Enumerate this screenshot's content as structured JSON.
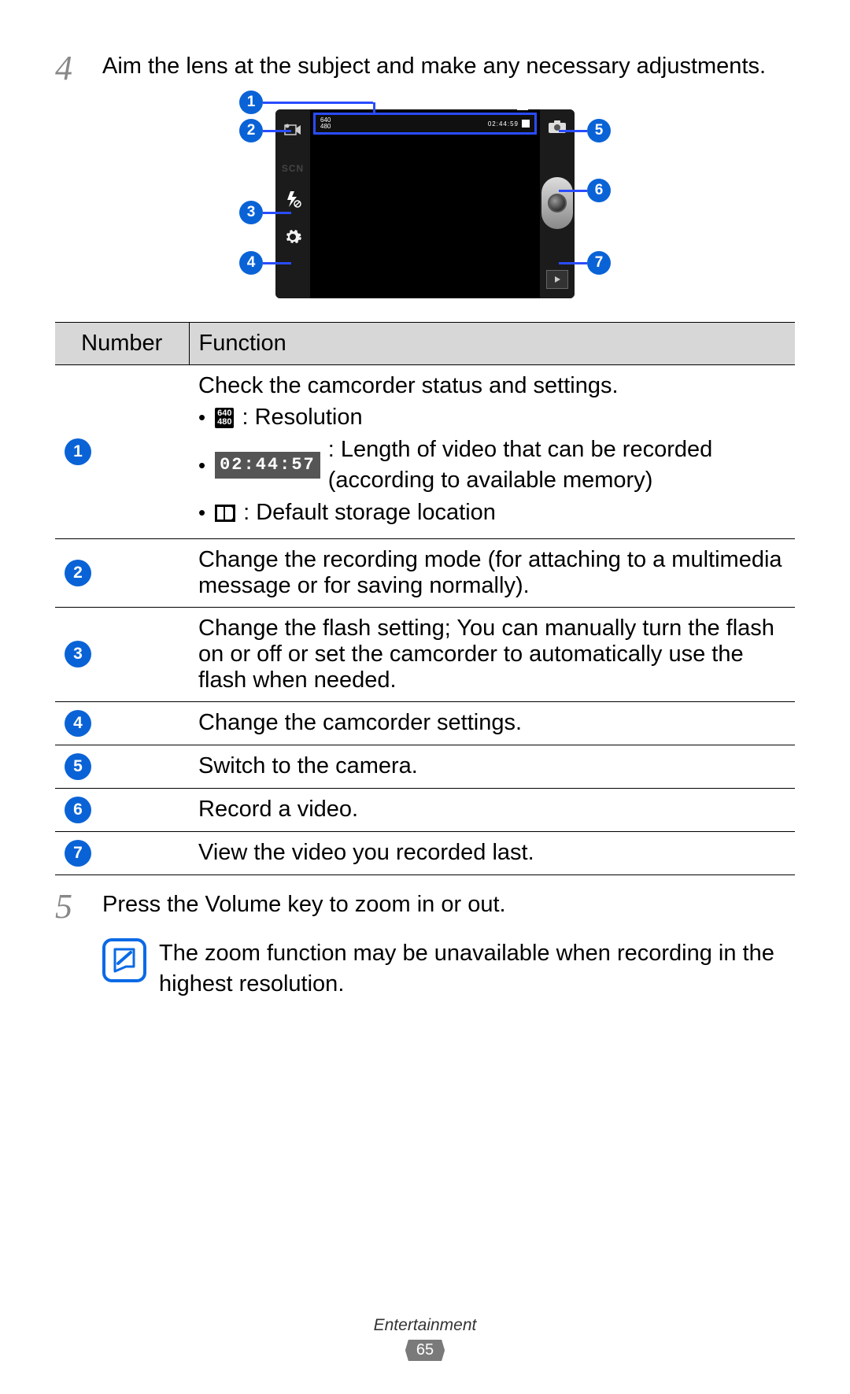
{
  "step4": {
    "num": "4",
    "text": "Aim the lens at the subject and make any necessary adjustments."
  },
  "diagram": {
    "status_res_top": "640",
    "status_res_bot": "480",
    "status_time": "02:44:59",
    "scn": "SCN"
  },
  "table": {
    "head_number": "Number",
    "head_function": "Function",
    "rows": [
      {
        "num": "1",
        "lead": "Check the camcorder status and settings.",
        "bullets": [
          {
            "icon": "res",
            "text": ": Resolution"
          },
          {
            "icon": "time",
            "text": ": Length of video that can be recorded (according to available memory)"
          },
          {
            "icon": "store",
            "text": ": Default storage location"
          }
        ]
      },
      {
        "num": "2",
        "text": "Change the recording mode (for attaching to a multimedia message or for saving normally)."
      },
      {
        "num": "3",
        "text": "Change the flash setting; You can manually turn the flash on or off or set the camcorder to automatically use the flash when needed."
      },
      {
        "num": "4",
        "text": "Change the camcorder settings."
      },
      {
        "num": "5",
        "text": "Switch to the camera."
      },
      {
        "num": "6",
        "text": "Record a video."
      },
      {
        "num": "7",
        "text": "View the video you recorded last."
      }
    ],
    "res_chip_top": "640",
    "res_chip_bot": "480",
    "time_chip": "02:44:57"
  },
  "step5": {
    "num": "5",
    "text": "Press the Volume key to zoom in or out."
  },
  "note": {
    "text": "The zoom function may be unavailable when recording in the highest resolution."
  },
  "footer": {
    "section": "Entertainment",
    "page": "65"
  }
}
